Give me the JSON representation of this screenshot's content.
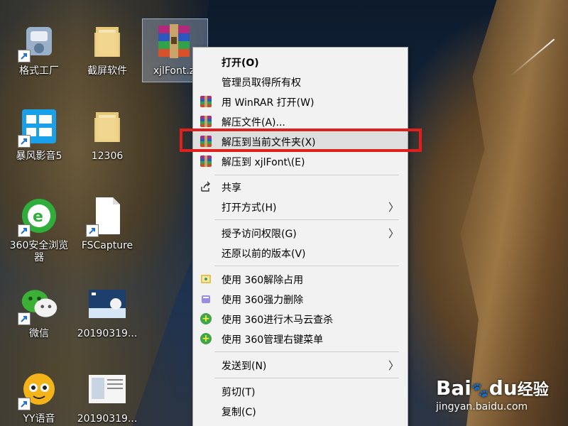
{
  "desktop": {
    "icons": [
      {
        "label": "格式工厂",
        "icon": "format-factory-icon",
        "shortcut": true
      },
      {
        "label": "截屏软件",
        "icon": "folder-icon",
        "shortcut": false
      },
      {
        "label": "xjlFont.z",
        "icon": "winrar-archive-icon",
        "shortcut": false
      },
      {
        "label": "暴风影音5",
        "icon": "storm-player-icon",
        "shortcut": true
      },
      {
        "label": "12306",
        "icon": "folder-icon",
        "shortcut": false
      },
      {
        "label": "360安全浏览器",
        "icon": "360-browser-icon",
        "shortcut": true
      },
      {
        "label": "FSCapture",
        "icon": "file-icon",
        "shortcut": true
      },
      {
        "label": "微信",
        "icon": "wechat-icon",
        "shortcut": true
      },
      {
        "label": "20190319...",
        "icon": "image-thumbnail-icon",
        "shortcut": false
      },
      {
        "label": "YY语音",
        "icon": "yy-voice-icon",
        "shortcut": true
      },
      {
        "label": "20190319...",
        "icon": "image-thumbnail-icon",
        "shortcut": false
      }
    ]
  },
  "context_menu": {
    "items": [
      {
        "label": "打开(O)",
        "icon": null,
        "bold": true
      },
      {
        "label": "管理员取得所有权",
        "icon": null
      },
      {
        "label": "用 WinRAR 打开(W)",
        "icon": "winrar-icon"
      },
      {
        "label": "解压文件(A)...",
        "icon": "winrar-icon"
      },
      {
        "label": "解压到当前文件夹(X)",
        "icon": "winrar-icon",
        "highlighted": true
      },
      {
        "label": "解压到 xjlFont\\(E)",
        "icon": "winrar-icon"
      },
      {
        "label": "共享",
        "icon": "share-icon"
      },
      {
        "label": "打开方式(H)",
        "icon": null,
        "submenu": true
      },
      {
        "label": "授予访问权限(G)",
        "icon": null,
        "submenu": true
      },
      {
        "label": "还原以前的版本(V)",
        "icon": null
      },
      {
        "label": "使用 360解除占用",
        "icon": "360-unlock-icon"
      },
      {
        "label": "使用 360强力删除",
        "icon": "360-shred-icon"
      },
      {
        "label": "使用 360进行木马云查杀",
        "icon": "360-scan-icon"
      },
      {
        "label": "使用 360管理右键菜单",
        "icon": "360-manage-icon"
      },
      {
        "label": "发送到(N)",
        "icon": null,
        "submenu": true
      },
      {
        "label": "剪切(T)",
        "icon": null
      },
      {
        "label": "复制(C)",
        "icon": null
      }
    ],
    "submenu_arrow": "〉"
  },
  "watermark": {
    "brand": "Bai",
    "paw": "du",
    "suffix": "经验",
    "url": "jingyan.baidu.com"
  },
  "colors": {
    "highlight_box": "#e0201c",
    "menu_bg": "#f2f2f2",
    "hover_bg": "#dedede"
  }
}
